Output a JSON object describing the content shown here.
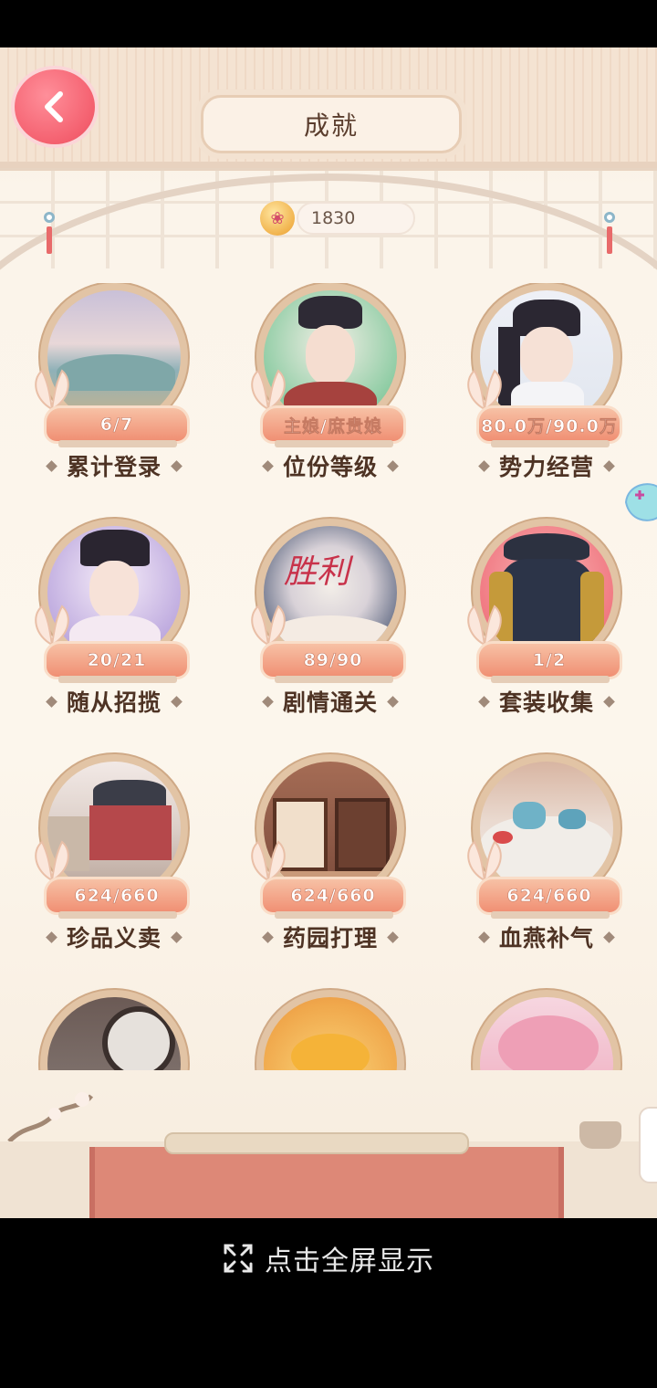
{
  "header": {
    "title": "成就",
    "back_icon": "chevron-left-icon"
  },
  "currency": {
    "icon": "coin-icon",
    "value": "1830"
  },
  "achievements": [
    {
      "label": "累计登录",
      "progress": "6/7",
      "theme": "landscape"
    },
    {
      "label": "位份等级",
      "progress": "主娘/庶贵娘",
      "theme": "consort"
    },
    {
      "label": "势力经营",
      "progress": "80.0万/90.0万",
      "theme": "lady-flute"
    },
    {
      "label": "随从招揽",
      "progress": "20/21",
      "theme": "attendant"
    },
    {
      "label": "剧情通关",
      "progress": "89/90",
      "theme": "victory",
      "emblem": "胜利"
    },
    {
      "label": "套装收集",
      "progress": "1/2",
      "theme": "robe"
    },
    {
      "label": "珍品义卖",
      "progress": "624/660",
      "theme": "street"
    },
    {
      "label": "药园打理",
      "progress": "624/660",
      "theme": "hall"
    },
    {
      "label": "血燕补气",
      "progress": "624/660",
      "theme": "tea"
    },
    {
      "label": "",
      "progress": "",
      "theme": "window"
    },
    {
      "label": "",
      "progress": "",
      "theme": "gold"
    },
    {
      "label": "",
      "progress": "",
      "theme": "blossom"
    }
  ],
  "footer": {
    "fullscreen_label": "点击全屏显示",
    "fullscreen_icon": "expand-icon"
  }
}
